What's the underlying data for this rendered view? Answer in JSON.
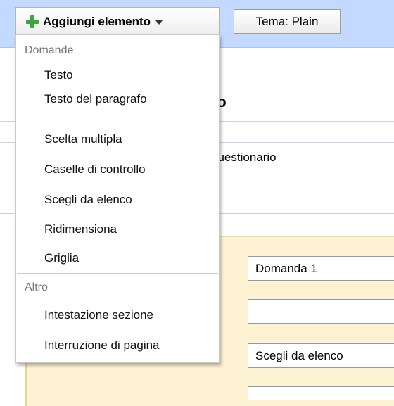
{
  "toolbar": {
    "add_label": "Aggiungi elemento",
    "theme_label": "Tema:  Plain",
    "plus_icon": "plus-icon",
    "caret_icon": "chevron-down-icon",
    "accent_color": "#3ea63e",
    "bar_color": "#c3d9ff"
  },
  "form": {
    "title_fragment": "ilo",
    "description_fragment": "questionario",
    "panel_color": "#fdf3d2"
  },
  "question": {
    "title_value": "Domanda 1",
    "help_value": "",
    "type_value": "Scegli da elenco"
  },
  "menu": {
    "groups": [
      {
        "header": "Domande",
        "items": [
          "Testo",
          "Testo del paragrafo",
          "Scelta multipla",
          "Caselle di controllo",
          "Scegli da elenco",
          "Ridimensiona",
          "Griglia"
        ]
      },
      {
        "header": "Altro",
        "items": [
          "Intestazione sezione",
          "Interruzione di pagina"
        ]
      }
    ]
  }
}
